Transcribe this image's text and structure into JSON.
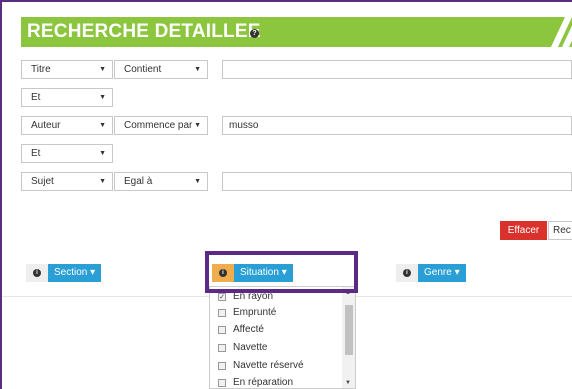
{
  "header": {
    "title": "RECHERCHE DETAILLEE",
    "info_icon": "info-icon"
  },
  "rows": [
    {
      "field": "Titre",
      "operator": "Contient",
      "value": ""
    },
    {
      "connector": "Et"
    },
    {
      "field": "Auteur",
      "operator": "Commence par",
      "value": "musso"
    },
    {
      "connector": "Et"
    },
    {
      "field": "Sujet",
      "operator": "Egal à",
      "value": ""
    }
  ],
  "actions": {
    "clear": "Effacer",
    "search": "Rec"
  },
  "filters": {
    "section": "Section",
    "situation": "Situation",
    "genre": "Genre"
  },
  "situation_options": [
    {
      "label": "En rayon",
      "checked": true
    },
    {
      "label": "Emprunté",
      "checked": false
    },
    {
      "label": "Affecté",
      "checked": false
    },
    {
      "label": "Navette",
      "checked": false
    },
    {
      "label": "Navette réservé",
      "checked": false
    },
    {
      "label": "En réparation",
      "checked": false
    }
  ],
  "colors": {
    "banner": "#8cc63f",
    "filter_button": "#2a9fd6",
    "clear_button": "#d9312b",
    "highlight": "#5b2a86",
    "situation_icon": "#f0ad4e"
  }
}
